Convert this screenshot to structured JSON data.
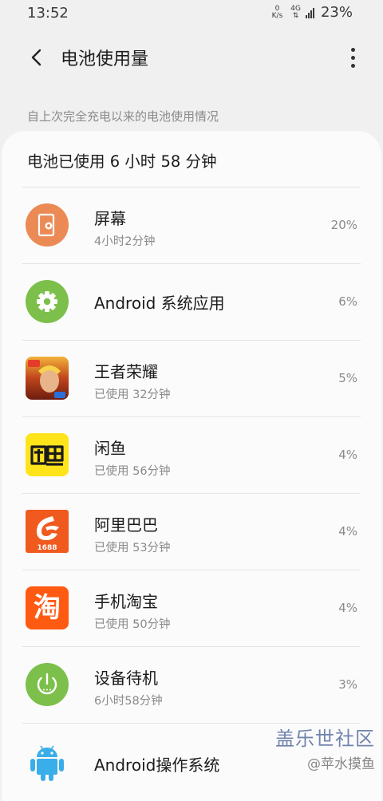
{
  "status": {
    "time": "13:52",
    "net_speed_value": "0",
    "net_speed_unit": "K/s",
    "network": "4G",
    "battery": "23%"
  },
  "appbar": {
    "title": "电池使用量"
  },
  "section_label": "自上次完全充电以来的电池使用情况",
  "summary": "电池已使用 6 小时 58 分钟",
  "apps": [
    {
      "name": "屏幕",
      "sub": "4小时2分钟",
      "percent": "20%",
      "icon": "screen-icon",
      "color": "#ec8a55"
    },
    {
      "name": "Android 系统应用",
      "sub": "",
      "percent": "6%",
      "icon": "settings-gear-icon",
      "color": "#7cc04b"
    },
    {
      "name": "王者荣耀",
      "sub": "已使用 32分钟",
      "percent": "5%",
      "icon": "honor-of-kings-icon",
      "color": "#b03a1a"
    },
    {
      "name": "闲鱼",
      "sub": "已使用 56分钟",
      "percent": "4%",
      "icon": "xianyu-icon",
      "color": "#ffe41c"
    },
    {
      "name": "阿里巴巴",
      "sub": "已使用 53分钟",
      "percent": "4%",
      "icon": "alibaba-1688-icon",
      "color": "#f05a1e",
      "badge": "1688"
    },
    {
      "name": "手机淘宝",
      "sub": "已使用 50分钟",
      "percent": "4%",
      "icon": "taobao-icon",
      "color": "#ff5a12",
      "glyph": "淘"
    },
    {
      "name": "设备待机",
      "sub": "6小时58分钟",
      "percent": "3%",
      "icon": "power-standby-icon",
      "color": "#7cc04b"
    },
    {
      "name": "Android操作系统",
      "sub": "",
      "percent": "",
      "icon": "android-robot-icon",
      "color": "#3aaee8"
    }
  ],
  "watermark": {
    "line1": "盖乐世社区",
    "line2": "@苹水摸鱼"
  }
}
